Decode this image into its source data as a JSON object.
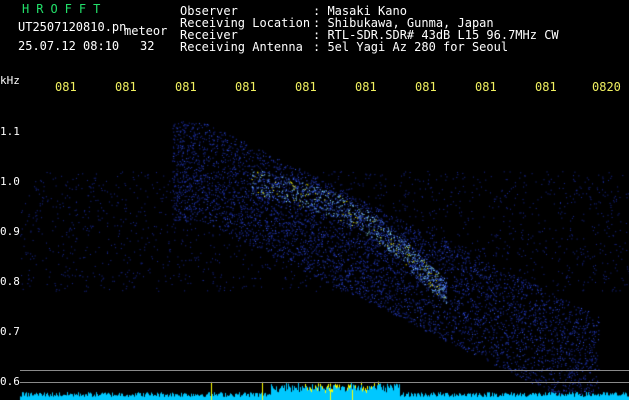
{
  "header": {
    "software": "HROFFT",
    "filename": "UT2507120810.pn",
    "class_label": "meteor",
    "timestamp": "25.07.12 08:10",
    "count": "32",
    "fields": [
      {
        "label": "Observer",
        "value": ": Masaki Kano"
      },
      {
        "label": "Receiving Location",
        "value": ": Shibukawa, Gunma, Japan"
      },
      {
        "label": "Receiver",
        "value": ": RTL-SDR.SDR# 43dB L15 96.7MHz CW"
      },
      {
        "label": "Receiving Antenna",
        "value": ": 5el Yagi Az 280 for Seoul"
      }
    ]
  },
  "chart_data": {
    "type": "heatmap",
    "ylabel": "kHz",
    "y_ticks": [
      "1.1",
      "1.0",
      "0.9",
      "0.8",
      "0.7",
      "0.6"
    ],
    "x_ticks": [
      "081",
      "081",
      "081",
      "081",
      "081",
      "081",
      "081",
      "081",
      "081",
      "0820"
    ],
    "ylim": [
      0.58,
      1.16
    ],
    "meteor_trace": [
      {
        "t": 0.38,
        "f": 1.0
      },
      {
        "t": 0.45,
        "f": 0.98
      },
      {
        "t": 0.52,
        "f": 0.95
      },
      {
        "t": 0.58,
        "f": 0.91
      },
      {
        "t": 0.63,
        "f": 0.86
      },
      {
        "t": 0.67,
        "f": 0.81
      },
      {
        "t": 0.7,
        "f": 0.78
      }
    ],
    "colors": {
      "background": "#000000",
      "signal_low": "#1a2a9a",
      "signal_high": "#8fe8ff",
      "peak": "#ffff00",
      "noise_bar": "#00c8ff"
    }
  }
}
